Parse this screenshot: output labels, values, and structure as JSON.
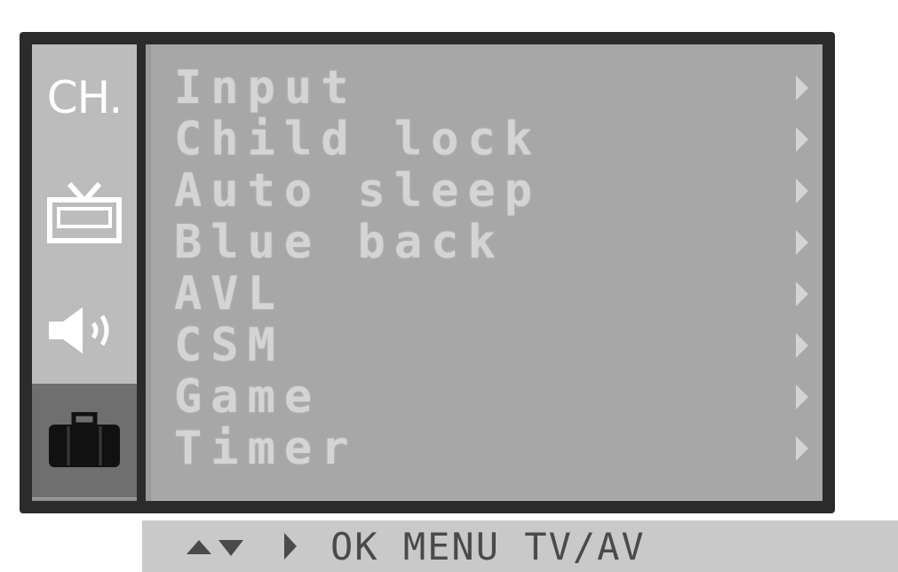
{
  "osd_menu": {
    "tabs": [
      {
        "id": "channel",
        "label": "CH.",
        "icon": "channel-text"
      },
      {
        "id": "picture",
        "label": "",
        "icon": "tv-icon"
      },
      {
        "id": "sound",
        "label": "",
        "icon": "speaker-icon"
      },
      {
        "id": "special",
        "label": "",
        "icon": "toolbox-icon",
        "selected": true
      }
    ],
    "items": [
      {
        "label": "Input"
      },
      {
        "label": "Child lock"
      },
      {
        "label": "Auto sleep"
      },
      {
        "label": "Blue back"
      },
      {
        "label": "AVL"
      },
      {
        "label": "CSM"
      },
      {
        "label": "Game"
      },
      {
        "label": "Timer"
      }
    ]
  },
  "hint_bar": {
    "updown_icon": "up-down-arrows-icon",
    "right_icon": "right-arrow-icon",
    "text": "OK MENU TV/AV"
  },
  "colors": {
    "frame": "#2b2b2b",
    "panel": "#a7a7a7",
    "tab_bg": "#bcbcbc",
    "tab_selected": "#6f6f6f",
    "item_text": "#d4d4d4",
    "hint_bg": "#c9c9c9"
  }
}
